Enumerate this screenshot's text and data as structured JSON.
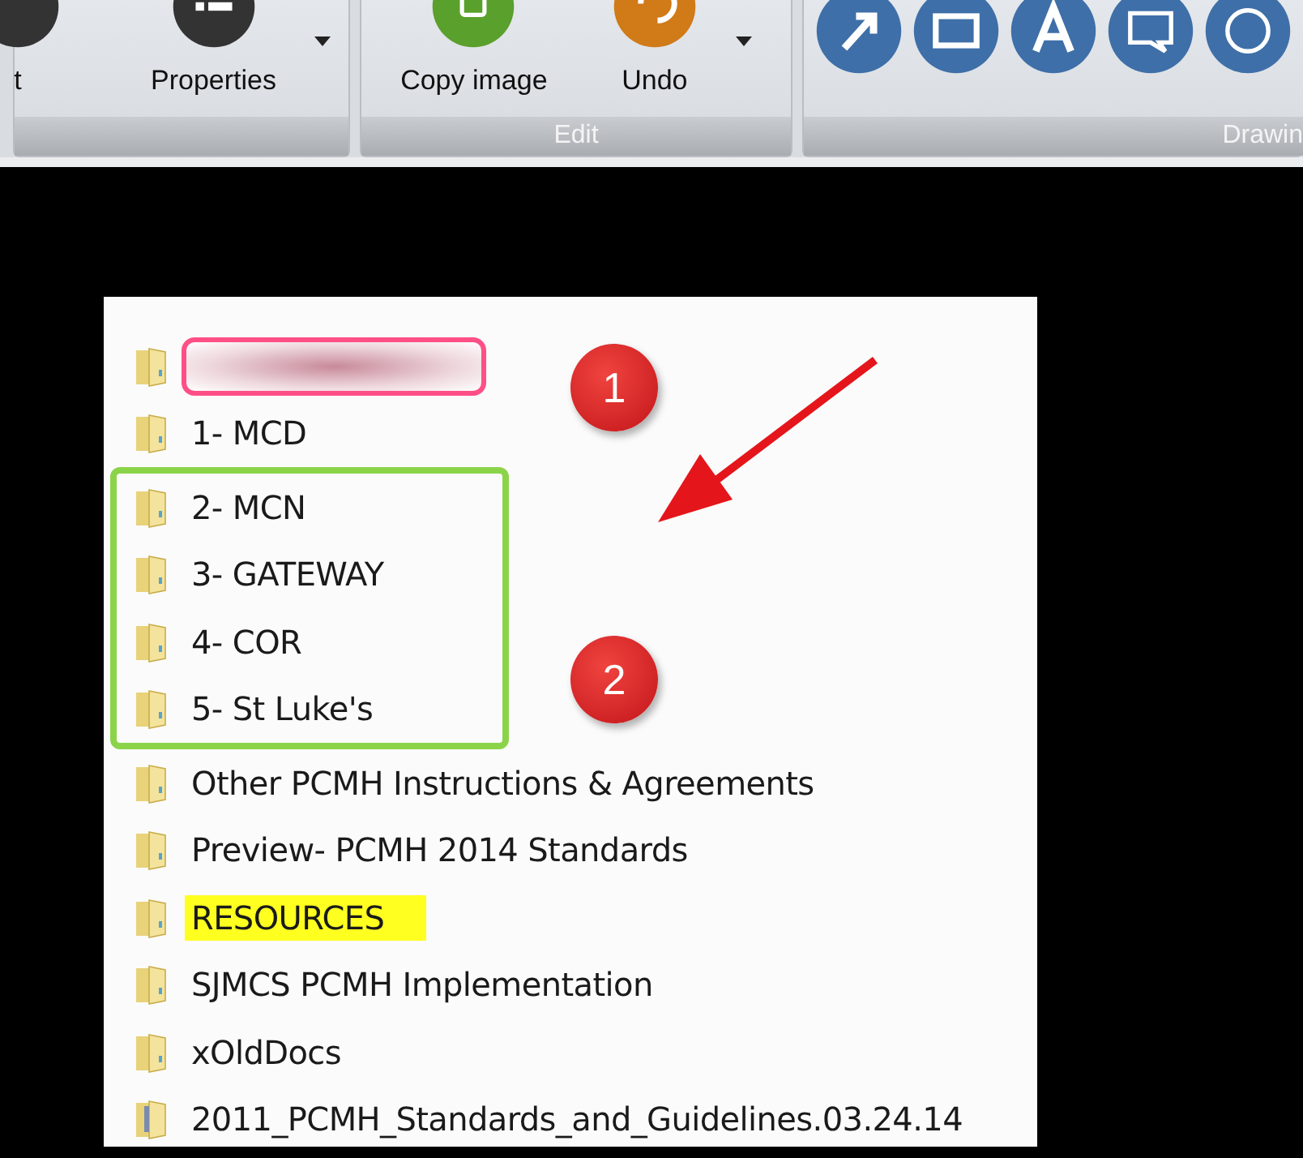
{
  "ribbon": {
    "groups": [
      {
        "buttons": [
          {
            "label": "t",
            "dropdown": false
          },
          {
            "label": "Properties",
            "dropdown": true
          }
        ]
      },
      {
        "label": "Edit",
        "buttons": [
          {
            "label": "Copy image",
            "dropdown": false
          },
          {
            "label": "Undo",
            "dropdown": true
          }
        ]
      },
      {
        "label": "Drawin",
        "buttons": [
          {
            "dropdown": false
          },
          {
            "dropdown": false
          },
          {
            "dropdown": false
          },
          {
            "dropdown": false
          },
          {
            "dropdown": false
          }
        ]
      }
    ]
  },
  "folder_list": {
    "items": [
      {
        "kind": "folder",
        "redacted": true,
        "boxed": false,
        "highlighted": false
      },
      {
        "label": "1- MCD",
        "kind": "folder",
        "redacted": false,
        "boxed": false,
        "highlighted": false
      },
      {
        "label": "2- MCN",
        "kind": "folder",
        "redacted": false,
        "boxed": true,
        "highlighted": false
      },
      {
        "label": "3- GATEWAY",
        "kind": "folder",
        "redacted": false,
        "boxed": true,
        "highlighted": false
      },
      {
        "label": "4- COR",
        "kind": "folder",
        "redacted": false,
        "boxed": true,
        "highlighted": false
      },
      {
        "label": "5- St Luke's",
        "kind": "folder",
        "redacted": false,
        "boxed": true,
        "highlighted": false
      },
      {
        "label": "Other PCMH Instructions & Agreements",
        "kind": "folder",
        "redacted": false,
        "boxed": false,
        "highlighted": false
      },
      {
        "label": "Preview- PCMH 2014 Standards",
        "kind": "folder",
        "redacted": false,
        "boxed": false,
        "highlighted": false
      },
      {
        "label": "RESOURCES",
        "kind": "folder",
        "redacted": false,
        "boxed": false,
        "highlighted": true
      },
      {
        "label": "SJMCS PCMH Implementation",
        "kind": "folder",
        "redacted": false,
        "boxed": false,
        "highlighted": false
      },
      {
        "label": "xOldDocs",
        "kind": "folder",
        "redacted": false,
        "boxed": false,
        "highlighted": false
      },
      {
        "label": "2011_PCMH_Standards_and_Guidelines.03.24.14",
        "kind": "archive",
        "redacted": false,
        "boxed": false,
        "highlighted": false
      }
    ]
  },
  "annotations": {
    "badges": [
      {
        "text": "1"
      },
      {
        "text": "2"
      }
    ]
  }
}
